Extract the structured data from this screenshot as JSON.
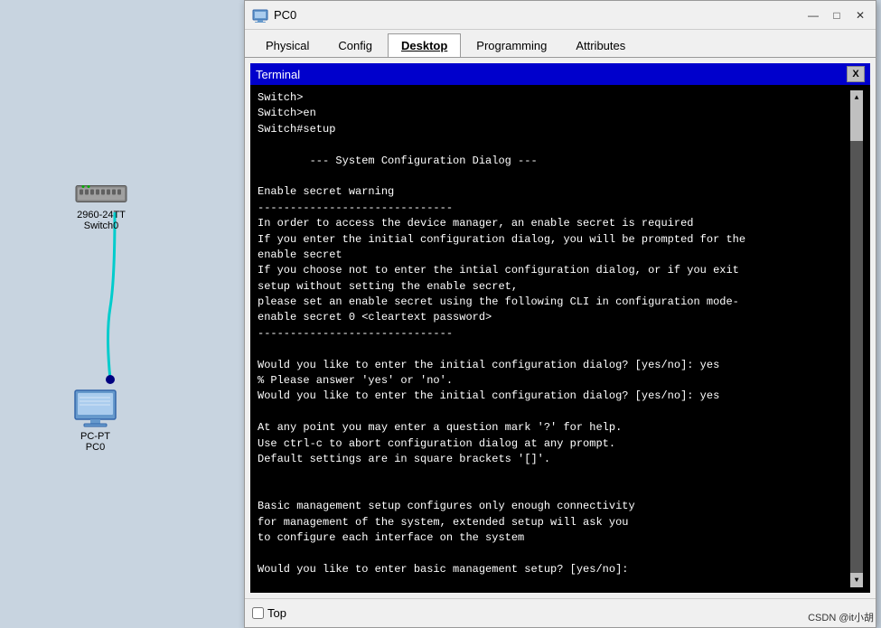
{
  "canvas": {
    "background_color": "#c8d4e0"
  },
  "switch_device": {
    "label_line1": "2960-24TT",
    "label_line2": "Switch0"
  },
  "pc_device": {
    "label_line1": "PC-PT",
    "label_line2": "PC0"
  },
  "window": {
    "title": "PC0",
    "title_icon": "computer-icon",
    "controls": {
      "minimize": "—",
      "maximize": "□",
      "close": "✕"
    }
  },
  "tabs": [
    {
      "id": "physical",
      "label": "Physical",
      "active": false
    },
    {
      "id": "config",
      "label": "Config",
      "active": false
    },
    {
      "id": "desktop",
      "label": "Desktop",
      "active": true
    },
    {
      "id": "programming",
      "label": "Programming",
      "active": false
    },
    {
      "id": "attributes",
      "label": "Attributes",
      "active": false
    }
  ],
  "terminal": {
    "header_label": "Terminal",
    "close_button": "X",
    "content": "Switch>\nSwitch>en\nSwitch#setup\n\n        --- System Configuration Dialog ---\n\nEnable secret warning\n------------------------------\nIn order to access the device manager, an enable secret is required\nIf you enter the initial configuration dialog, you will be prompted for the\nenable secret\nIf you choose not to enter the intial configuration dialog, or if you exit\nsetup without setting the enable secret,\nplease set an enable secret using the following CLI in configuration mode-\nenable secret 0 <cleartext password>\n------------------------------\n\nWould you like to enter the initial configuration dialog? [yes/no]: yes\n% Please answer 'yes' or 'no'.\nWould you like to enter the initial configuration dialog? [yes/no]: yes\n\nAt any point you may enter a question mark '?' for help.\nUse ctrl-c to abort configuration dialog at any prompt.\nDefault settings are in square brackets '[]'.\n\n\nBasic management setup configures only enough connectivity\nfor management of the system, extended setup will ask you\nto configure each interface on the system\n\nWould you like to enter basic management setup? [yes/no]:"
  },
  "bottom_bar": {
    "checkbox_label": "Top",
    "checkbox_checked": false
  },
  "watermark": {
    "text": "CSDN @it小胡"
  }
}
